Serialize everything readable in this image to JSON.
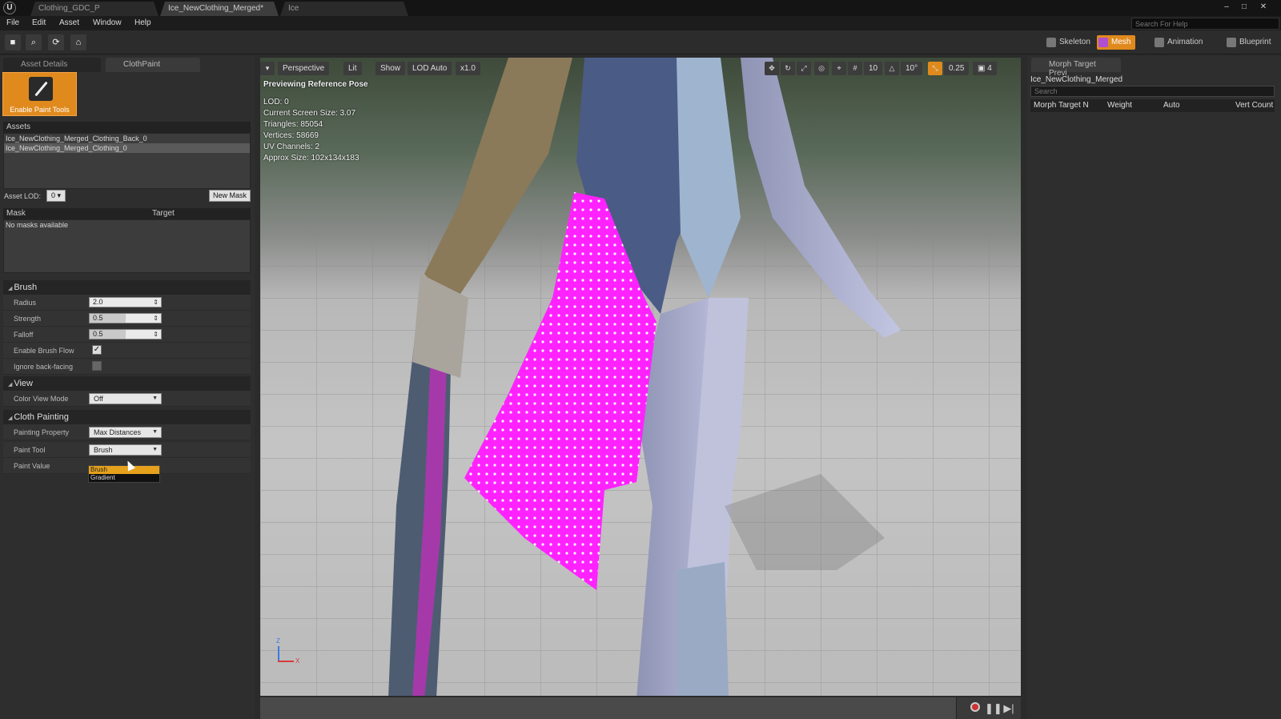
{
  "window": {
    "tabs": [
      "Clothing_GDC_P",
      "Ice_NewClothing_Merged*",
      "Ice"
    ],
    "controls": [
      "–",
      "□",
      "✕"
    ]
  },
  "menu": [
    "File",
    "Edit",
    "Asset",
    "Window",
    "Help"
  ],
  "help_search": {
    "placeholder": "Search For Help"
  },
  "modes": [
    {
      "label": "Skeleton",
      "active": false
    },
    {
      "label": "Mesh",
      "active": true
    },
    {
      "label": "Animation",
      "active": false
    },
    {
      "label": "Blueprint",
      "active": false
    }
  ],
  "left_panel": {
    "tabs": [
      "Asset Details",
      "ClothPaint"
    ],
    "paint_button_label": "Enable Paint Tools",
    "assets_header": "Assets",
    "assets": [
      {
        "name": "Ice_NewClothing_Merged_Clothing_Back_0",
        "selected": false
      },
      {
        "name": "Ice_NewClothing_Merged_Clothing_0",
        "selected": true
      }
    ],
    "asset_lod_label": "Asset LOD:",
    "asset_lod_value": "0",
    "new_mask_label": "New Mask",
    "mask_columns": [
      "Mask",
      "Target"
    ],
    "no_masks": "No masks available",
    "brush": {
      "title": "Brush",
      "radius_label": "Radius",
      "radius": "2.0",
      "strength_label": "Strength",
      "strength": "0.5",
      "strength_fraction": 0.5,
      "falloff_label": "Falloff",
      "falloff": "0.5",
      "falloff_fraction": 0.5,
      "flow_label": "Enable Brush Flow",
      "flow": true,
      "backfacing_label": "Ignore back-facing",
      "backfacing": false
    },
    "view": {
      "title": "View",
      "color_view_label": "Color View Mode",
      "color_view": "Off"
    },
    "cloth": {
      "title": "Cloth Painting",
      "property_label": "Painting Property",
      "property": "Max Distances",
      "tool_label": "Paint Tool",
      "tool": "Brush",
      "value_label": "Paint Value",
      "tool_options": [
        "Brush",
        "Gradient"
      ],
      "highlighted_option": "Brush"
    }
  },
  "viewport": {
    "toolbar": [
      "Perspective",
      "Lit",
      "Show",
      "LOD Auto",
      "x1.0"
    ],
    "right_tools": [
      "10",
      "10°",
      "0.25",
      "4"
    ],
    "mode_text": "Previewing Reference Pose",
    "stats": [
      "LOD: 0",
      "Current Screen Size: 3.07",
      "Triangles: 85054",
      "Vertices: 58669",
      "UV Channels: 2",
      "Approx Size: 102x134x183"
    ],
    "axis": {
      "z": "Z",
      "x": "X"
    },
    "paint_color": "#ff22ff"
  },
  "right_panel": {
    "tab": "Morph Target Previ",
    "asset_name": "Ice_NewClothing_Merged",
    "search_placeholder": "Search",
    "columns": [
      "Morph Target N",
      "Weight",
      "Auto",
      "Vert Count"
    ]
  },
  "colors": {
    "accent": "#e08a1e",
    "dropdown_highlight": "#e6a11c"
  }
}
